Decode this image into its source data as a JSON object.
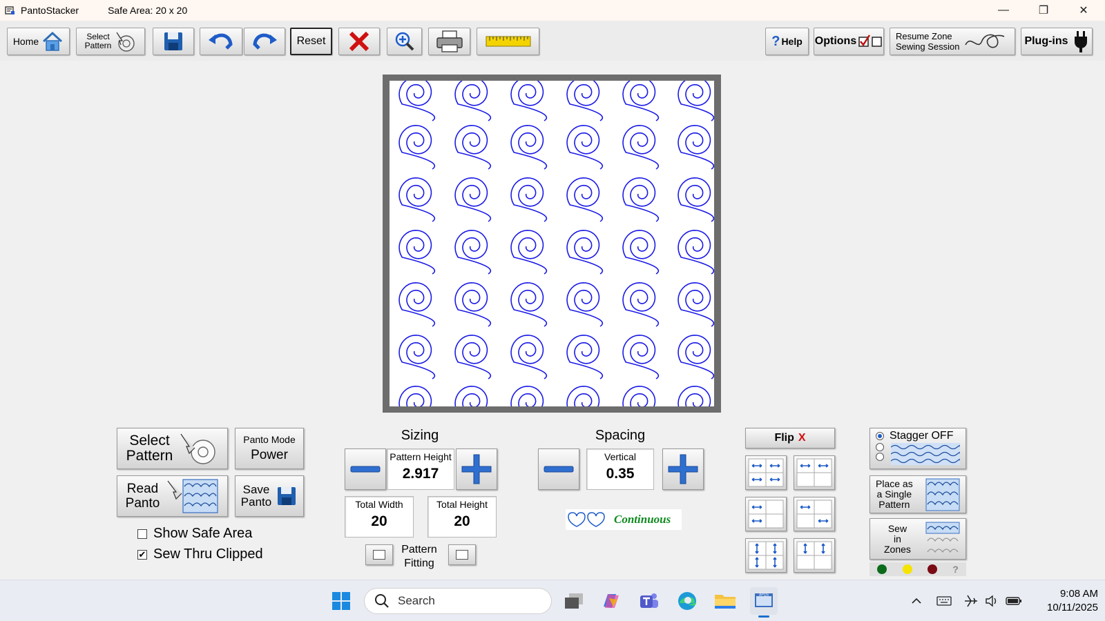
{
  "titlebar": {
    "app_name": "PantoStacker",
    "safe_area": "Safe Area: 20 x 20",
    "minimize": "—",
    "restore": "❐",
    "close": "✕"
  },
  "toolbar": {
    "home_label": "Home",
    "select_line1": "Select",
    "select_line2": "Pattern",
    "reset_label": "Reset",
    "help_q": "?",
    "help_label": "Help",
    "options_label": "Options",
    "resume_line1": "Resume Zone",
    "resume_line2": "Sewing Session",
    "plugins_label": "Plug-ins"
  },
  "canvas": {
    "pattern_color": "#1a1ae6",
    "frame_color": "#6d6d6d"
  },
  "left_panel": {
    "select_line1": "Select",
    "select_line2": "Pattern",
    "panto_mode_label": "Panto Mode",
    "panto_mode_value": "Power",
    "read_line1": "Read",
    "read_line2": "Panto",
    "save_line1": "Save",
    "save_line2": "Panto",
    "show_safe_area": "Show Safe Area",
    "show_safe_area_checked": false,
    "sew_thru_clipped": "Sew Thru Clipped",
    "sew_thru_clipped_checked": true,
    "check_mark": "✔"
  },
  "sizing": {
    "title": "Sizing",
    "pattern_height_label": "Pattern Height",
    "pattern_height_value": "2.917",
    "total_width_label": "Total Width",
    "total_width_value": "20",
    "total_height_label": "Total Height",
    "total_height_value": "20",
    "pattern_fitting_line1": "Pattern",
    "pattern_fitting_line2": "Fitting"
  },
  "spacing": {
    "title": "Spacing",
    "vertical_label": "Vertical",
    "vertical_value": "0.35",
    "continuous_label": "Continuous"
  },
  "flip": {
    "label": "Flip",
    "x": "X"
  },
  "stagger": {
    "label": "Stagger OFF",
    "place_line1": "Place as",
    "place_line2": "a Single",
    "place_line3": "Pattern",
    "sew_line1": "Sew",
    "sew_line2": "in",
    "sew_line3": "Zones",
    "status_q": "?"
  },
  "taskbar": {
    "search_placeholder": "Search",
    "time": "9:08 AM",
    "date": "10/11/2025"
  }
}
